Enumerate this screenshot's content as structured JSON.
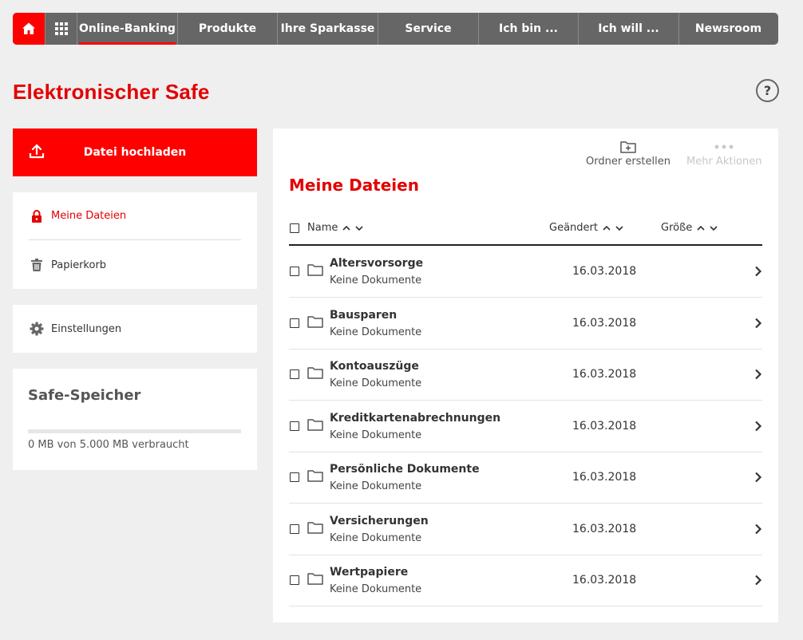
{
  "nav": {
    "items": [
      {
        "label": "Online-Banking",
        "width": 126,
        "active": true
      },
      {
        "label": "Produkte",
        "width": 125
      },
      {
        "label": "Ihre Sparkasse",
        "width": 126
      },
      {
        "label": "Service",
        "width": 126
      },
      {
        "label": "Ich bin ...",
        "width": 125
      },
      {
        "label": "Ich will ...",
        "width": 126
      },
      {
        "label": "Newsroom",
        "width": 125
      }
    ]
  },
  "page": {
    "title": "Elektronischer Safe",
    "help_label": "?"
  },
  "sidebar": {
    "upload_label": "Datei hochladen",
    "my_files_label": "Meine Dateien",
    "trash_label": "Papierkorb",
    "settings_label": "Einstellungen",
    "storage": {
      "title": "Safe-Speicher",
      "text": "0 MB von 5.000 MB verbraucht",
      "used_fraction": 0
    }
  },
  "main": {
    "create_folder_label": "Ordner erstellen",
    "more_actions_label": "Mehr Aktionen",
    "title": "Meine Dateien",
    "columns": {
      "name": "Name",
      "changed": "Geändert",
      "size": "Größe"
    },
    "rows": [
      {
        "name": "Altersvorsorge",
        "sub": "Keine Dokumente",
        "date": "16.03.2018"
      },
      {
        "name": "Bausparen",
        "sub": "Keine Dokumente",
        "date": "16.03.2018"
      },
      {
        "name": "Kontoauszüge",
        "sub": "Keine Dokumente",
        "date": "16.03.2018"
      },
      {
        "name": "Kreditkartenabrechnungen",
        "sub": "Keine Dokumente",
        "date": "16.03.2018"
      },
      {
        "name": "Persönliche Dokumente",
        "sub": "Keine Dokumente",
        "date": "16.03.2018"
      },
      {
        "name": "Versicherungen",
        "sub": "Keine Dokumente",
        "date": "16.03.2018"
      },
      {
        "name": "Wertpapiere",
        "sub": "Keine Dokumente",
        "date": "16.03.2018"
      }
    ]
  },
  "colors": {
    "accent": "#e30000",
    "nav_bg": "#666666",
    "page_bg": "#efefef"
  }
}
